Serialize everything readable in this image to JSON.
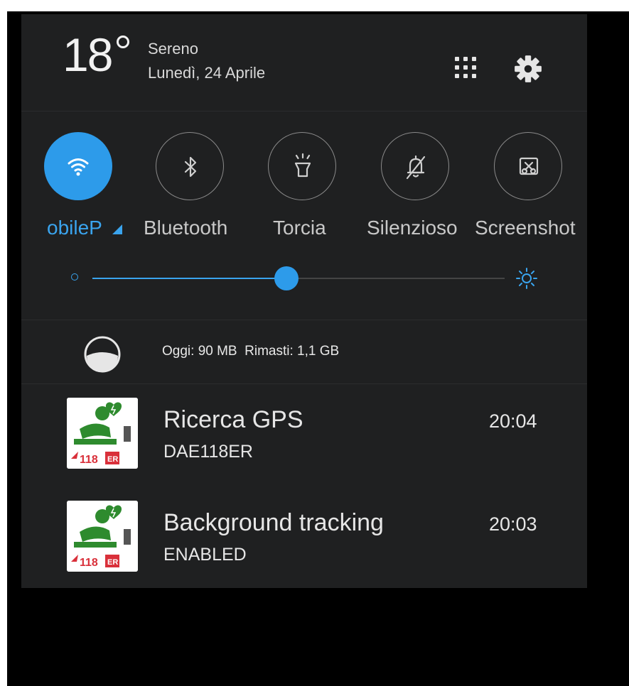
{
  "header": {
    "temperature": "18",
    "condition": "Sereno",
    "date": "Lunedì, 24 Aprile"
  },
  "toggles": [
    {
      "label": "obileP",
      "icon": "wifi-icon",
      "active": true
    },
    {
      "label": "Bluetooth",
      "icon": "bluetooth-icon",
      "active": false
    },
    {
      "label": "Torcia",
      "icon": "flashlight-icon",
      "active": false
    },
    {
      "label": "Silenzioso",
      "icon": "bell-off-icon",
      "active": false
    },
    {
      "label": "Screenshot",
      "icon": "screenshot-icon",
      "active": false
    }
  ],
  "brightness": {
    "level": 0.47
  },
  "data_usage": {
    "text": "Oggi: 90 MB  Rimasti: 1,1 GB"
  },
  "notifications": [
    {
      "title": "Ricerca GPS",
      "subtitle": "DAE118ER",
      "time": "20:04"
    },
    {
      "title": "Background tracking",
      "subtitle": "ENABLED",
      "time": "20:03"
    }
  ],
  "colors": {
    "accent": "#2d9bea",
    "panel": "#1f2021",
    "background": "#000000"
  }
}
